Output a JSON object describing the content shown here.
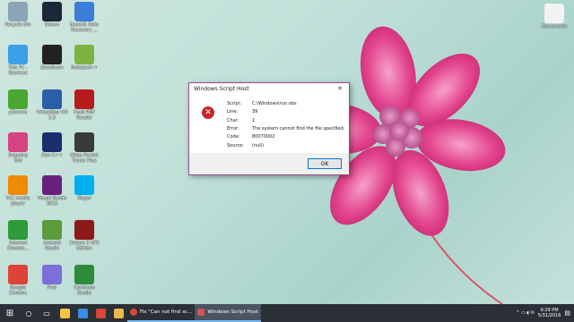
{
  "desktop_icons": [
    {
      "label": "Recycle Bin",
      "icon": "recycle-bin-icon",
      "color": "#8aa4b8"
    },
    {
      "label": "Steam",
      "icon": "steam-icon",
      "color": "#1b2838"
    },
    {
      "label": "EaseUS Data\nRecovery ...",
      "icon": "easeus-icon",
      "color": "#3b7dd8"
    },
    {
      "label": "This PC -\nShortcut",
      "icon": "this-pc-icon",
      "color": "#3aa0e8"
    },
    {
      "label": "Bandicam",
      "icon": "bandicam-icon",
      "color": "#222222"
    },
    {
      "label": "Notepad++",
      "icon": "notepadpp-icon",
      "color": "#7cb342"
    },
    {
      "label": "µTorrent",
      "icon": "utorrent-icon",
      "color": "#4aa832"
    },
    {
      "label": "VirtualBox VM\n3.3",
      "icon": "virtualbox-icon",
      "color": "#2c5ea8"
    },
    {
      "label": "Foxit PDF\nReader",
      "icon": "pdf-reader-icon",
      "color": "#b71c1c"
    },
    {
      "label": "Snipping\nTool",
      "icon": "snipping-tool-icon",
      "color": "#d84383"
    },
    {
      "label": "Dev C++",
      "icon": "devcpp-icon",
      "color": "#1a2f6b"
    },
    {
      "label": "Glass Pocket\nTracer Plus",
      "icon": "tracer-icon",
      "color": "#3a3a3a"
    },
    {
      "label": "VLC media\nplayer",
      "icon": "vlc-icon",
      "color": "#f08a00"
    },
    {
      "label": "Visual Studio\n2015",
      "icon": "visual-studio-icon",
      "color": "#68217a"
    },
    {
      "label": "Skype",
      "icon": "skype-icon",
      "color": "#00aff0"
    },
    {
      "label": "Internet\nDownlo...",
      "icon": "idm-icon",
      "color": "#2e9a3a"
    },
    {
      "label": "Android\nStudio",
      "icon": "android-studio-icon",
      "color": "#5b9b3d"
    },
    {
      "label": "Dream 3 VFX\nEdition",
      "icon": "vfx-icon",
      "color": "#8c1a1a"
    },
    {
      "label": "Google\nChrome",
      "icon": "chrome-icon",
      "color": "#db4437"
    },
    {
      "label": "Pixlr",
      "icon": "pixlr-icon",
      "color": "#7c6fd8"
    },
    {
      "label": "Camtasia\nStudio",
      "icon": "camtasia-icon",
      "color": "#2f8b3c"
    },
    {
      "label": "Documents",
      "icon": "documents-icon",
      "color": "#f2f2f2"
    }
  ],
  "dialog": {
    "title": "Windows Script Host",
    "close_glyph": "✕",
    "error_glyph": "✕",
    "fields": [
      {
        "key": "Script:",
        "value": "C:\\Windows\\run.vbs"
      },
      {
        "key": "Line:",
        "value": "39"
      },
      {
        "key": "Char:",
        "value": "1"
      },
      {
        "key": "Error:",
        "value": "The system cannot find the file specified."
      },
      {
        "key": "Code:",
        "value": "80070002"
      },
      {
        "key": "Source:",
        "value": "(null)"
      }
    ],
    "ok_label": "OK"
  },
  "taskbar": {
    "start_glyph": "⊞",
    "search_glyph": "○",
    "task_view_glyph": "▭",
    "pinned": [
      {
        "name": "file-explorer-icon",
        "color": "#f4c542"
      },
      {
        "name": "store-icon",
        "color": "#3a8ee6"
      },
      {
        "name": "chrome-icon",
        "color": "#db4437"
      },
      {
        "name": "folder-icon",
        "color": "#e8b84a"
      }
    ],
    "windows": [
      {
        "label": "Fix \"Can not find sc...",
        "active": false,
        "icon_color": "#db4437"
      },
      {
        "label": "Windows Script Host",
        "active": true,
        "icon_color": "#d9534f"
      }
    ],
    "tray_glyphs": "^ ▭ ◖ ✉",
    "time": "9:29 PM",
    "date": "5/31/2016",
    "notification_glyph": "▤"
  }
}
